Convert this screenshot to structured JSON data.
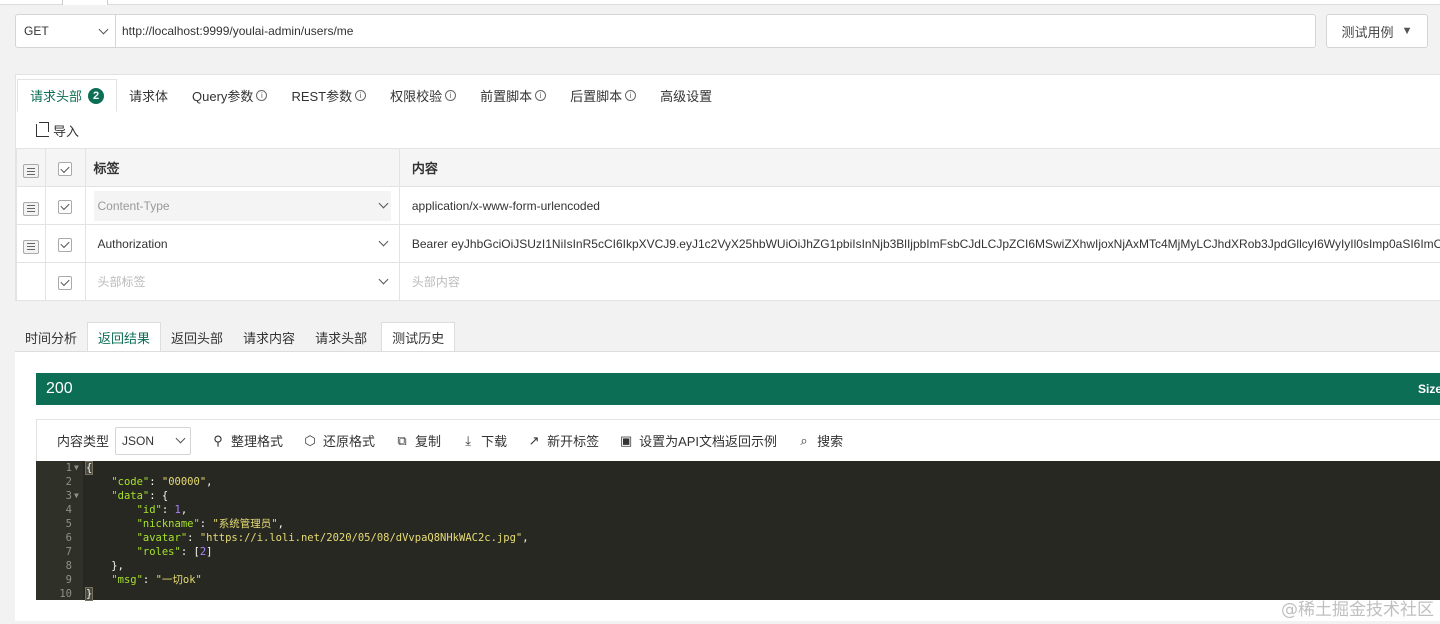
{
  "request": {
    "method": "GET",
    "url": "http://localhost:9999/youlai-admin/users/me",
    "test_case_label": "测试用例"
  },
  "request_tabs": [
    {
      "label": "请求头部",
      "badge": "2",
      "info": false
    },
    {
      "label": "请求体",
      "info": false
    },
    {
      "label": "Query参数",
      "info": true
    },
    {
      "label": "REST参数",
      "info": true
    },
    {
      "label": "权限校验",
      "info": true
    },
    {
      "label": "前置脚本",
      "info": true
    },
    {
      "label": "后置脚本",
      "info": true
    },
    {
      "label": "高级设置",
      "info": false
    }
  ],
  "import_label": "导入",
  "info_glyph": "i",
  "headers_table": {
    "col_key": "标签",
    "col_value": "内容",
    "rows": [
      {
        "key": "Content-Type",
        "value": "application/x-www-form-urlencoded"
      },
      {
        "key": "Authorization",
        "value": "Bearer eyJhbGciOiJSUzI1NiIsInR5cCI6IkpXVCJ9.eyJ1c2VyX25hbWUiOiJhZG1pbiIsInNjb3BlIjpbImFsbCJdLCJpZCI6MSwiZXhwIjoxNjAxMTc4MjMyLCJhdXRob3JpdGllcyI6WyIyIl0sImp0aSI6ImO"
      }
    ],
    "placeholder_key": "头部标签",
    "placeholder_value": "头部内容"
  },
  "response_tabs": [
    "时间分析",
    "返回结果",
    "返回头部",
    "请求内容",
    "请求头部",
    "测试历史"
  ],
  "response": {
    "status_code": "200",
    "size_label": "Size:"
  },
  "toolbar": {
    "content_type_label": "内容类型",
    "content_type_value": "JSON",
    "format": "整理格式",
    "restore": "还原格式",
    "copy": "复制",
    "download": "下载",
    "new_tab": "新开标签",
    "set_example": "设置为API文档返回示例",
    "search": "搜索"
  },
  "json_body": {
    "code_key": "\"code\"",
    "code_val": "\"00000\"",
    "data_key": "\"data\"",
    "id_key": "\"id\"",
    "id_val": "1",
    "nickname_key": "\"nickname\"",
    "nickname_val": "\"系统管理员\"",
    "avatar_key": "\"avatar\"",
    "avatar_val": "\"https://i.loli.net/2020/05/08/dVvpaQ8NHkWAC2c.jpg\"",
    "roles_key": "\"roles\"",
    "roles_val": "2",
    "msg_key": "\"msg\"",
    "msg_val": "\"一切ok\""
  },
  "watermark": "@稀土掘金技术社区"
}
